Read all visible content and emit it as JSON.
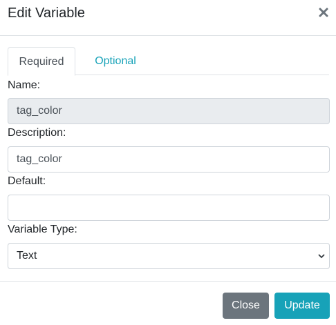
{
  "header": {
    "title": "Edit Variable",
    "close_icon": "close-icon"
  },
  "tabs": [
    {
      "label": "Required",
      "active": true
    },
    {
      "label": "Optional",
      "active": false
    }
  ],
  "form": {
    "name": {
      "label": "Name:",
      "value": "tag_color"
    },
    "description": {
      "label": "Description:",
      "value": "tag_color"
    },
    "default": {
      "label": "Default:",
      "value": ""
    },
    "variable_type": {
      "label": "Variable Type:",
      "value": "Text"
    }
  },
  "footer": {
    "close_label": "Close",
    "update_label": "Update"
  },
  "colors": {
    "accent": "#17a2b8",
    "secondary": "#6c757d",
    "readonly_bg": "#e9ecef",
    "border": "#ced4da"
  }
}
